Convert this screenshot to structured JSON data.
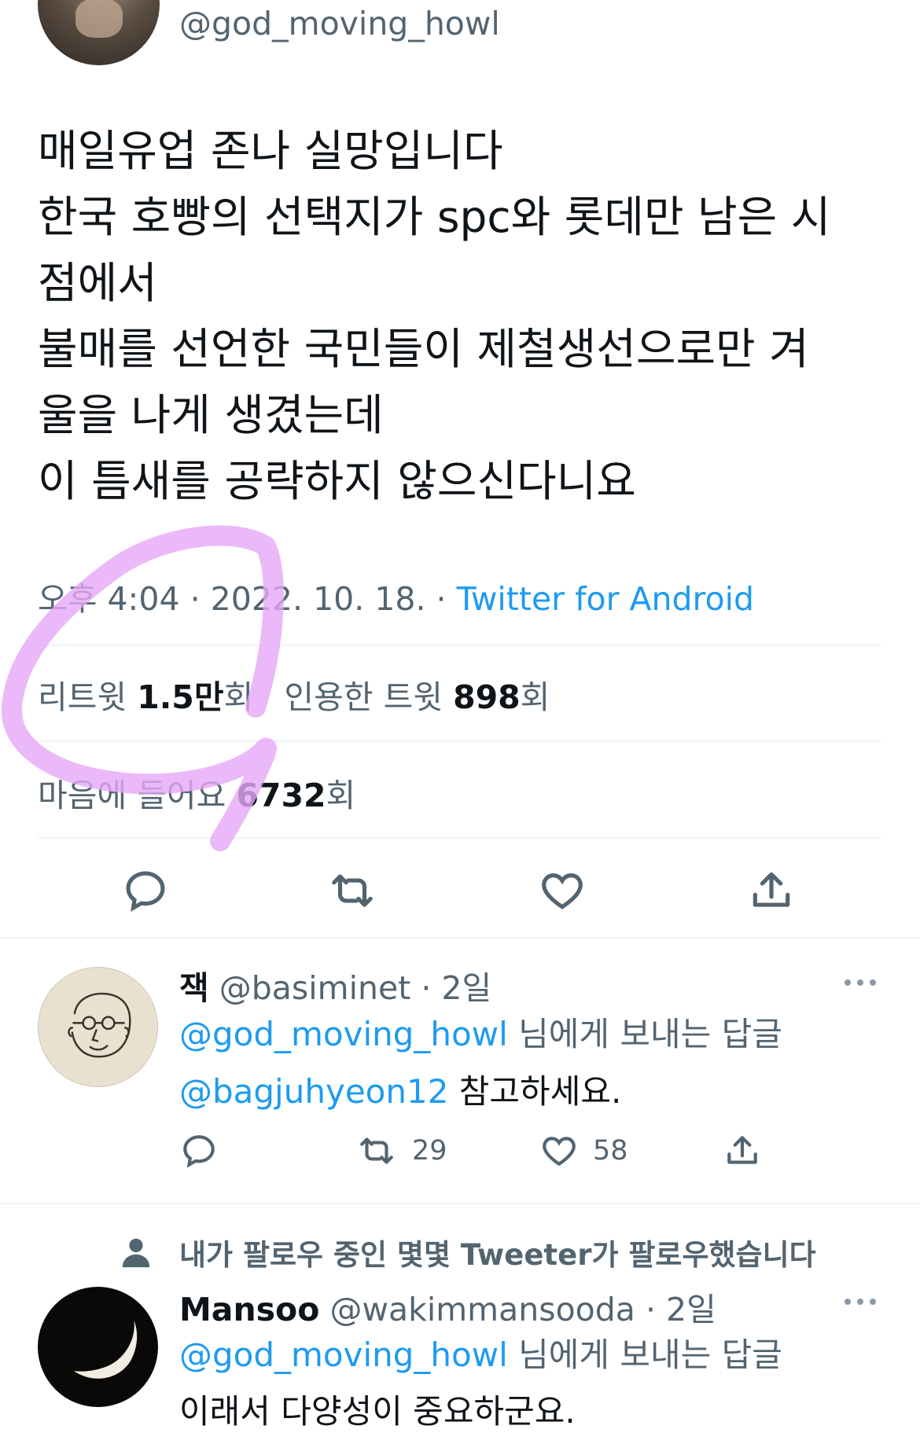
{
  "main_tweet": {
    "handle": "@god_moving_howl",
    "text_lines": [
      "매일유업 존나 실망입니다",
      "한국 호빵의 선택지가 spc와 롯데만 남은 시",
      "점에서",
      "불매를 선언한 국민들이 제철생선으로만 겨",
      "울을 나게 생겼는데",
      "이 틈새를 공략하지 않으신다니요"
    ],
    "meta": {
      "time": "오후 4:04",
      "sep1": " · ",
      "date": "2022. 10. 18.",
      "sep2": " · ",
      "source": "Twitter for Android"
    },
    "stats": {
      "retweet_label": "리트윗 ",
      "retweet_count": "1.5만",
      "retweet_suffix": "회",
      "quote_label": "인용한 트윗 ",
      "quote_count": "898",
      "quote_suffix": "회",
      "like_label": "마음에 들어요 ",
      "like_count": "6732",
      "like_suffix": "회"
    }
  },
  "replies": [
    {
      "name": "잭",
      "handle": "@basiminet",
      "time": "· 2일",
      "replying_to_handle": "@god_moving_howl",
      "replying_to_text": " 님에게 보내는 답글",
      "body_mention": "@bagjuhyeon12",
      "body_text": " 참고하세요.",
      "retweet_count": "29",
      "like_count": "58"
    },
    {
      "social_context": "내가 팔로우 중인 몇몇 Tweeter가 팔로우했습니다",
      "name": "Mansoo",
      "handle": "@wakimmansooda",
      "time": "· 2일",
      "replying_to_handle": "@god_moving_howl",
      "replying_to_text": " 님에게 보내는 답글",
      "body_text": "이래서 다양성이 중요하군요."
    }
  ],
  "colors": {
    "accent": "#1d9bf0",
    "muted": "#536471",
    "annotation": "#e6a8f7"
  },
  "icons": [
    "reply-icon",
    "retweet-icon",
    "like-icon",
    "share-icon",
    "more-icon",
    "person-icon"
  ]
}
